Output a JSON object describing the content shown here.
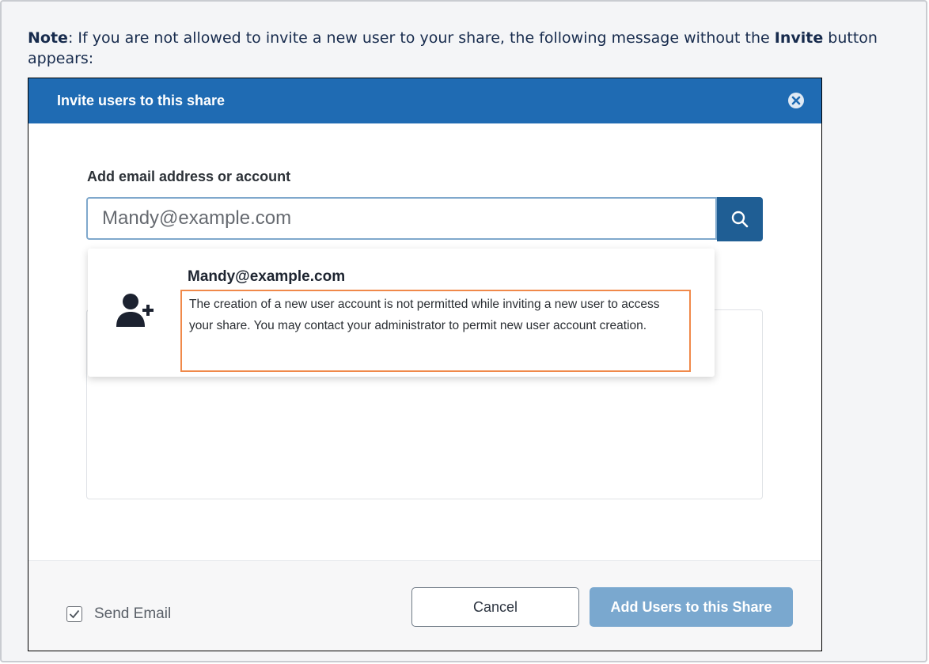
{
  "note": {
    "label": "Note",
    "text_before_bold": ": If you are not allowed to invite a new user to your share, the following message without the ",
    "bold_word": "Invite",
    "text_after_bold": " button appears:"
  },
  "dialog": {
    "title": "Invite users to this share",
    "field_label": "Add email address or account",
    "email_value": "Mandy@example.com",
    "suggestion": {
      "email": "Mandy@example.com",
      "message": "The creation of a new user account is not permitted while inviting a new user to access your share. You may contact your administrator to permit new user account creation."
    },
    "footer": {
      "send_email_label": "Send Email",
      "send_email_checked": true,
      "cancel_label": "Cancel",
      "add_label": "Add Users to this Share"
    }
  },
  "colors": {
    "header": "#1f6bb3",
    "search_button": "#1f5e94",
    "highlight_border": "#f0894a",
    "primary_button": "#7aa8cf"
  },
  "icons": [
    "close-icon",
    "search-icon",
    "add-user-icon",
    "checkmark-icon"
  ]
}
